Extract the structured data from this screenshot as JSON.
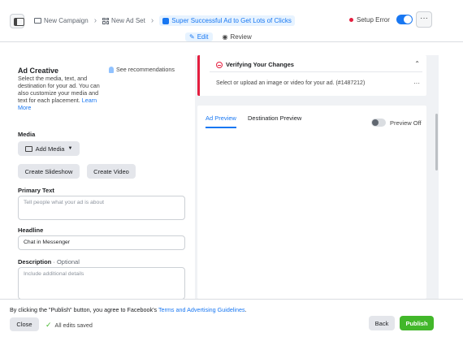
{
  "breadcrumb": {
    "campaign": "New Campaign",
    "adset": "New Ad Set",
    "ad": "Super Successful Ad to Get Lots of Clicks"
  },
  "header": {
    "setup_error": "Setup Error",
    "more": "···",
    "edit_label": "Edit",
    "review_label": "Review"
  },
  "creative": {
    "title": "Ad Creative",
    "description": "Select the media, text, and destination for your ad. You can also customize your media and text for each placement.",
    "learn_more": "Learn More",
    "see_recommendations": "See recommendations",
    "media_label": "Media",
    "add_media": "Add Media",
    "create_slideshow": "Create Slideshow",
    "create_video": "Create Video",
    "primary_text_label": "Primary Text",
    "primary_text_placeholder": "Tell people what your ad is about",
    "headline_label": "Headline",
    "headline_value": "Chat in Messenger",
    "description_label": "Description",
    "description_optional": "· Optional",
    "description_placeholder": "Include additional details"
  },
  "verify": {
    "title": "Verifying Your Changes",
    "message": "Select or upload an image or video for your ad. (#1487212)",
    "collapse": "⌃",
    "more": "···"
  },
  "preview": {
    "tab_ad": "Ad Preview",
    "tab_destination": "Destination Preview",
    "preview_off": "Preview Off"
  },
  "footer": {
    "terms_prefix": "By clicking the \"Publish\" button, you agree to Facebook's ",
    "terms_link": "Terms and Advertising Guidelines",
    "terms_suffix": ".",
    "close": "Close",
    "saved": "All edits saved",
    "back": "Back",
    "publish": "Publish"
  },
  "colors": {
    "accent": "#1877f2",
    "error": "#e41e3f",
    "publish": "#42b72a"
  },
  "icons": [
    "sidebar-toggle-icon",
    "folder-icon",
    "grid-icon",
    "square-icon",
    "error-dot-icon",
    "pencil-icon",
    "eye-icon",
    "bulb-icon",
    "image-icon",
    "warning-icon",
    "check-icon"
  ]
}
